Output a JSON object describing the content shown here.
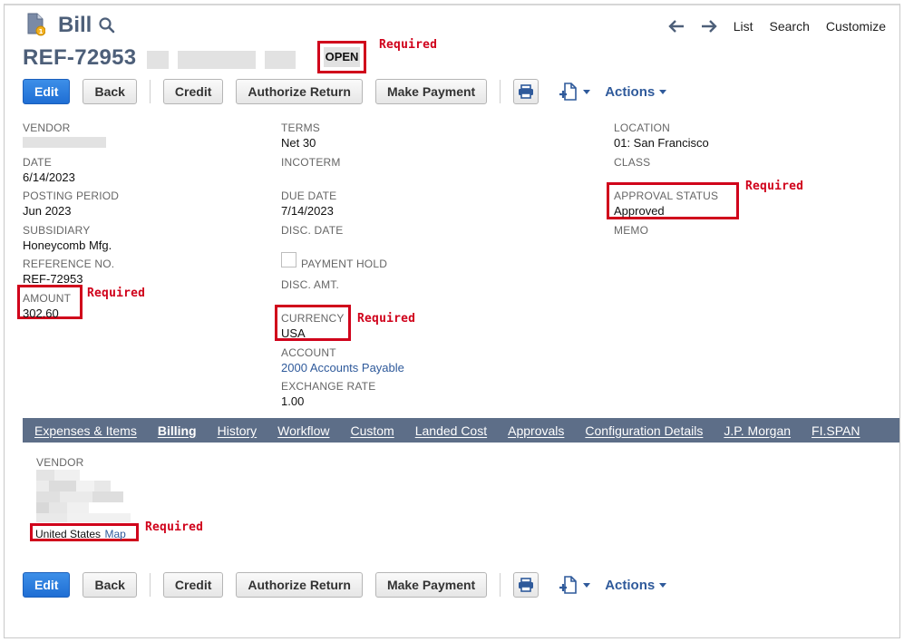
{
  "header": {
    "title": "Bill",
    "nav_links": [
      "List",
      "Search",
      "Customize"
    ]
  },
  "record": {
    "ref": "REF-72953",
    "status": "OPEN"
  },
  "annotation": {
    "required": "Required"
  },
  "toolbar": {
    "edit": "Edit",
    "back": "Back",
    "credit": "Credit",
    "authorize_return": "Authorize Return",
    "make_payment": "Make Payment",
    "actions": "Actions"
  },
  "fields": {
    "vendor": {
      "label": "VENDOR"
    },
    "date": {
      "label": "DATE",
      "value": "6/14/2023"
    },
    "posting_period": {
      "label": "POSTING PERIOD",
      "value": "Jun 2023"
    },
    "subsidiary": {
      "label": "SUBSIDIARY",
      "value": "Honeycomb Mfg."
    },
    "reference_no": {
      "label": "REFERENCE NO.",
      "value": "REF-72953"
    },
    "amount": {
      "label": "AMOUNT",
      "value": "302.60"
    },
    "terms": {
      "label": "TERMS",
      "value": "Net 30"
    },
    "incoterm": {
      "label": "INCOTERM"
    },
    "due_date": {
      "label": "DUE DATE",
      "value": "7/14/2023"
    },
    "disc_date": {
      "label": "DISC. DATE"
    },
    "payment_hold": {
      "label": "PAYMENT HOLD"
    },
    "disc_amt": {
      "label": "DISC. AMT."
    },
    "currency": {
      "label": "CURRENCY",
      "value": "USA"
    },
    "account": {
      "label": "ACCOUNT",
      "value": "2000 Accounts Payable"
    },
    "exchange_rate": {
      "label": "EXCHANGE RATE",
      "value": "1.00"
    },
    "location": {
      "label": "LOCATION",
      "value": "01: San Francisco"
    },
    "class": {
      "label": "CLASS"
    },
    "approval_status": {
      "label": "APPROVAL STATUS",
      "value": "Approved"
    },
    "memo": {
      "label": "MEMO"
    }
  },
  "tabs": [
    "Expenses & Items",
    "Billing",
    "History",
    "Workflow",
    "Custom",
    "Landed Cost",
    "Approvals",
    "Configuration Details",
    "J.P. Morgan",
    "FI.SPAN"
  ],
  "active_tab": "Billing",
  "billing": {
    "vendor_label": "VENDOR",
    "country": "United States",
    "map_link": "Map"
  },
  "colors": {
    "title": "#4d5f79",
    "tabbar": "#5d6e88",
    "link": "#2f5a9b",
    "primary_button": "#1f6ed4",
    "required_red": "#d0021b"
  },
  "icons": [
    "bill-record-icon",
    "search-icon",
    "arrow-left-icon",
    "arrow-right-icon",
    "print-icon",
    "new-document-icon",
    "chevron-down-icon"
  ]
}
